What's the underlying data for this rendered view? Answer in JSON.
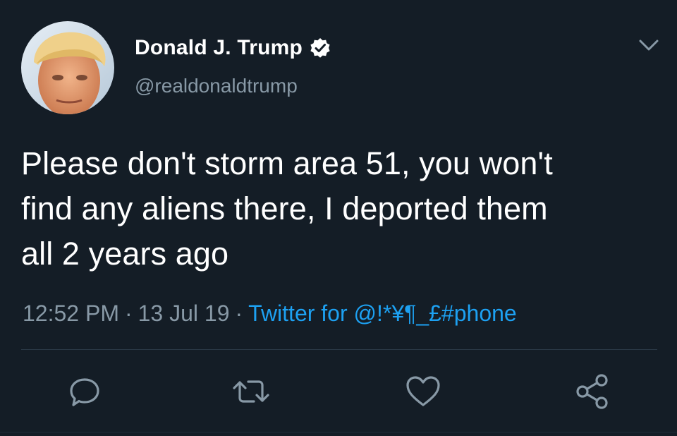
{
  "user": {
    "display_name": "Donald J. Trump",
    "handle": "@realdonaldtrump",
    "verified": true,
    "avatar_icon": "profile-photo"
  },
  "tweet": {
    "lines": [
      "Please don't storm area 51, you won't",
      "find any aliens there, I deported them",
      "all 2 years ago"
    ]
  },
  "meta": {
    "time": "12:52 PM",
    "separator": "·",
    "date": "13 Jul 19",
    "source": "Twitter for @!*¥¶_£#phone"
  },
  "actions": [
    {
      "icon": "reply-icon"
    },
    {
      "icon": "retweet-icon"
    },
    {
      "icon": "like-icon"
    },
    {
      "icon": "share-icon"
    }
  ],
  "colors": {
    "background": "#141d26",
    "text_primary": "#ffffff",
    "text_secondary": "#8899a6",
    "accent": "#1da1f2",
    "divider": "#2b3a48"
  }
}
